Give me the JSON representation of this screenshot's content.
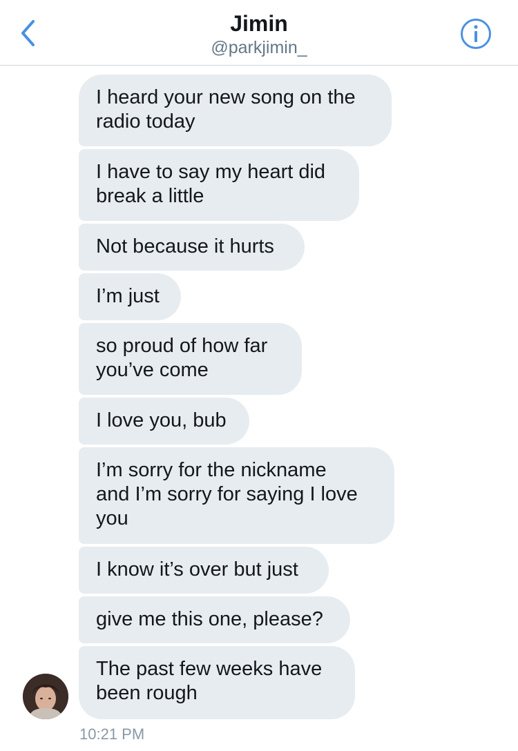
{
  "header": {
    "name": "Jimin",
    "handle": "@parkjimin_",
    "back_icon": "chevron-left-icon",
    "info_icon": "info-icon",
    "accent_color": "#4a90e2"
  },
  "messages": [
    {
      "lines": [
        "I heard your new song on the",
        "radio today"
      ]
    },
    {
      "lines": [
        "I have to say my heart did",
        "break a little"
      ]
    },
    {
      "lines": [
        "Not because it hurts"
      ]
    },
    {
      "lines": [
        "I’m just"
      ]
    },
    {
      "lines": [
        "so proud of how far",
        "you’ve come"
      ]
    },
    {
      "lines": [
        "I love you, bub"
      ]
    },
    {
      "lines": [
        "I’m sorry for the nickname",
        "and I’m sorry for saying I love",
        "you"
      ]
    },
    {
      "lines": [
        "I know it’s over but just"
      ]
    },
    {
      "lines": [
        "give me this one, please?"
      ]
    },
    {
      "lines": [
        "The past few weeks have",
        "been rough"
      ]
    }
  ],
  "timestamp": "10:21 PM",
  "bubble_color": "#e6ecf0"
}
